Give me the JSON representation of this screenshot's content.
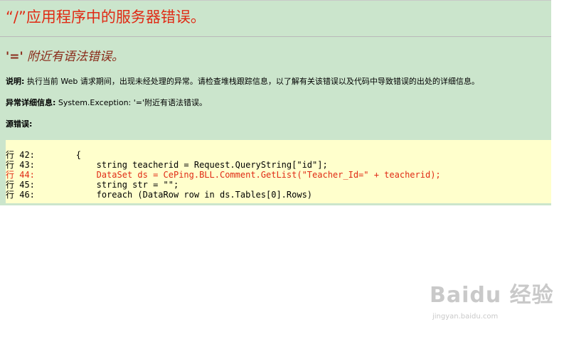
{
  "page": {
    "title": "“/”应用程序中的服务器错误。",
    "error_symbol": "'='",
    "error_heading_text": " 附近有语法错误。",
    "description_label": "说明:",
    "description_text": " 执行当前 Web 请求期间，出现未经处理的异常。请检查堆栈跟踪信息，以了解有关该错误以及代码中导致错误的出处的详细信息。",
    "exception_label": "异常详细信息:",
    "exception_text": " System.Exception: '='附近有语法错误。",
    "source_error_label": "源错误:"
  },
  "source_code": [
    {
      "text": "行 42:        {",
      "highlight": false
    },
    {
      "text": "行 43:            string teacherid = Request.QueryString[\"id\"];",
      "highlight": false
    },
    {
      "text": "行 44:            DataSet ds = CePing.BLL.Comment.GetList(\"Teacher_Id=\" + teacherid);",
      "highlight": true
    },
    {
      "text": "行 45:            string str = \"\";",
      "highlight": false
    },
    {
      "text": "行 46:            foreach (DataRow row in ds.Tables[0].Rows)",
      "highlight": false
    }
  ],
  "watermark": {
    "logo": "Baidu 经验",
    "url": "jingyan.baidu.com"
  },
  "colors": {
    "background_panel": "#cbe5cc",
    "code_background": "#ffffcc",
    "title_red": "#e02a14",
    "heading_maroon": "#8a2b1a",
    "watermark_gray": "#c9c9c9"
  }
}
